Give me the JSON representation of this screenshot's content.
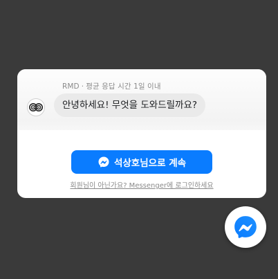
{
  "chat": {
    "page_name": "RMD",
    "separator": "·",
    "response_time": "평균 응답 시간 1일 이내",
    "greeting": "안녕하세요! 무엇을 도와드릴까요?",
    "continue_button_label": "석상호님으로 계속",
    "login_link": "회원님이 아닌가요? Messenger에 로그인하세요"
  },
  "icons": {
    "avatar": "rmd-logo-icon",
    "button_icon": "messenger-icon",
    "fab_icon": "messenger-icon"
  },
  "colors": {
    "background": "#3a3a3a",
    "button": "#0a7cff",
    "bubble": "#eaeaea",
    "text_muted": "#8a8a8a",
    "messenger_gradient_start": "#0099ff",
    "messenger_gradient_end": "#a033ff"
  }
}
